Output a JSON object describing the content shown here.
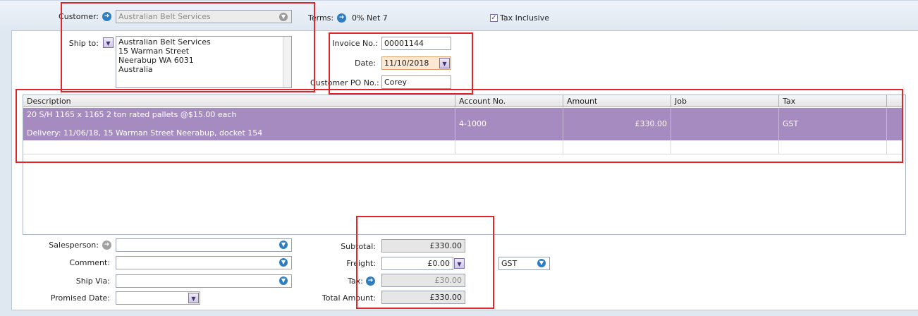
{
  "header": {
    "customer_label": "Customer:",
    "customer_value": "Australian Belt Services",
    "terms_label": "Terms:",
    "terms_value": "0% Net 7",
    "tax_inclusive_label": "Tax Inclusive",
    "tax_inclusive_checked": true
  },
  "ship_to": {
    "label": "Ship to:",
    "lines": [
      "Australian Belt Services",
      "15 Warman Street",
      "Neerabup  WA  6031",
      "Australia"
    ]
  },
  "invoice": {
    "invoice_no_label": "Invoice No.:",
    "invoice_no": "00001144",
    "date_label": "Date:",
    "date": "11/10/2018",
    "po_label": "Customer PO No.:",
    "po": "Corey"
  },
  "table": {
    "columns": [
      "Description",
      "Account No.",
      "Amount",
      "Job",
      "Tax"
    ],
    "rows": [
      {
        "description_line1": "20 S/H 1165 x 1165 2 ton rated pallets @$15.00 each",
        "description_line2": "Delivery: 11/06/18, 15 Warman Street Neerabup, docket 154",
        "account": "4-1000",
        "amount": "£330.00",
        "job": "",
        "tax": "GST"
      }
    ]
  },
  "footer": {
    "salesperson_label": "Salesperson:",
    "salesperson": "",
    "comment_label": "Comment:",
    "comment": "",
    "ship_via_label": "Ship Via:",
    "ship_via": "",
    "promised_date_label": "Promised Date:",
    "promised_date": "",
    "subtotal_label": "Subtotal:",
    "subtotal": "£330.00",
    "freight_label": "Freight:",
    "freight": "£0.00",
    "freight_tax": "GST",
    "tax_label": "Tax:",
    "tax": "£30.00",
    "total_label": "Total Amount:",
    "total": "£330.00"
  },
  "colors": {
    "selected_row": "#a68bc0",
    "annotation_red": "#e0262b",
    "date_field_bg": "#fbe7d2"
  }
}
